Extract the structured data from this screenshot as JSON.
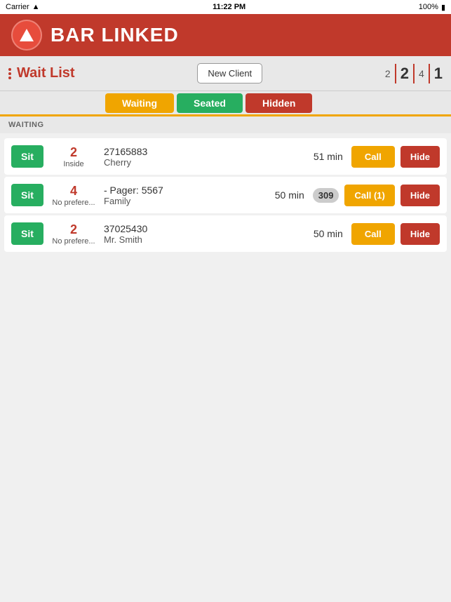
{
  "statusBar": {
    "carrier": "Carrier",
    "time": "11:22 PM",
    "battery": "100%"
  },
  "header": {
    "appTitle": "BAR LINKED",
    "logoAlt": "Bar Linked Logo"
  },
  "toolbar": {
    "dotsIcon": "dots-menu",
    "pageTitle": "Wait List",
    "newClientLabel": "New Client",
    "counters": [
      {
        "value": "2",
        "type": "small"
      },
      {
        "value": "2",
        "type": "large"
      },
      {
        "value": "4",
        "type": "small"
      },
      {
        "value": "1",
        "type": "large"
      }
    ]
  },
  "tabs": [
    {
      "id": "waiting",
      "label": "Waiting",
      "active": true
    },
    {
      "id": "seated",
      "label": "Seated",
      "active": false
    },
    {
      "id": "hidden",
      "label": "Hidden",
      "active": false
    }
  ],
  "sectionLabel": "WAITING",
  "waitList": [
    {
      "id": 1,
      "sitLabel": "Sit",
      "partySize": "2",
      "preference": "Inside",
      "phone": "27165883",
      "name": "Cherry",
      "waitTime": "51 min",
      "pager": null,
      "callLabel": "Call",
      "hideLabel": "Hide"
    },
    {
      "id": 2,
      "sitLabel": "Sit",
      "partySize": "4",
      "preference": "No prefere...",
      "phone": "- Pager: 5567",
      "name": "Family",
      "waitTime": "50 min",
      "pager": "309",
      "callLabel": "Call (1)",
      "hideLabel": "Hide"
    },
    {
      "id": 3,
      "sitLabel": "Sit",
      "partySize": "2",
      "preference": "No prefere...",
      "phone": "37025430",
      "name": "Mr. Smith",
      "waitTime": "50 min",
      "pager": null,
      "callLabel": "Call",
      "hideLabel": "Hide"
    }
  ]
}
